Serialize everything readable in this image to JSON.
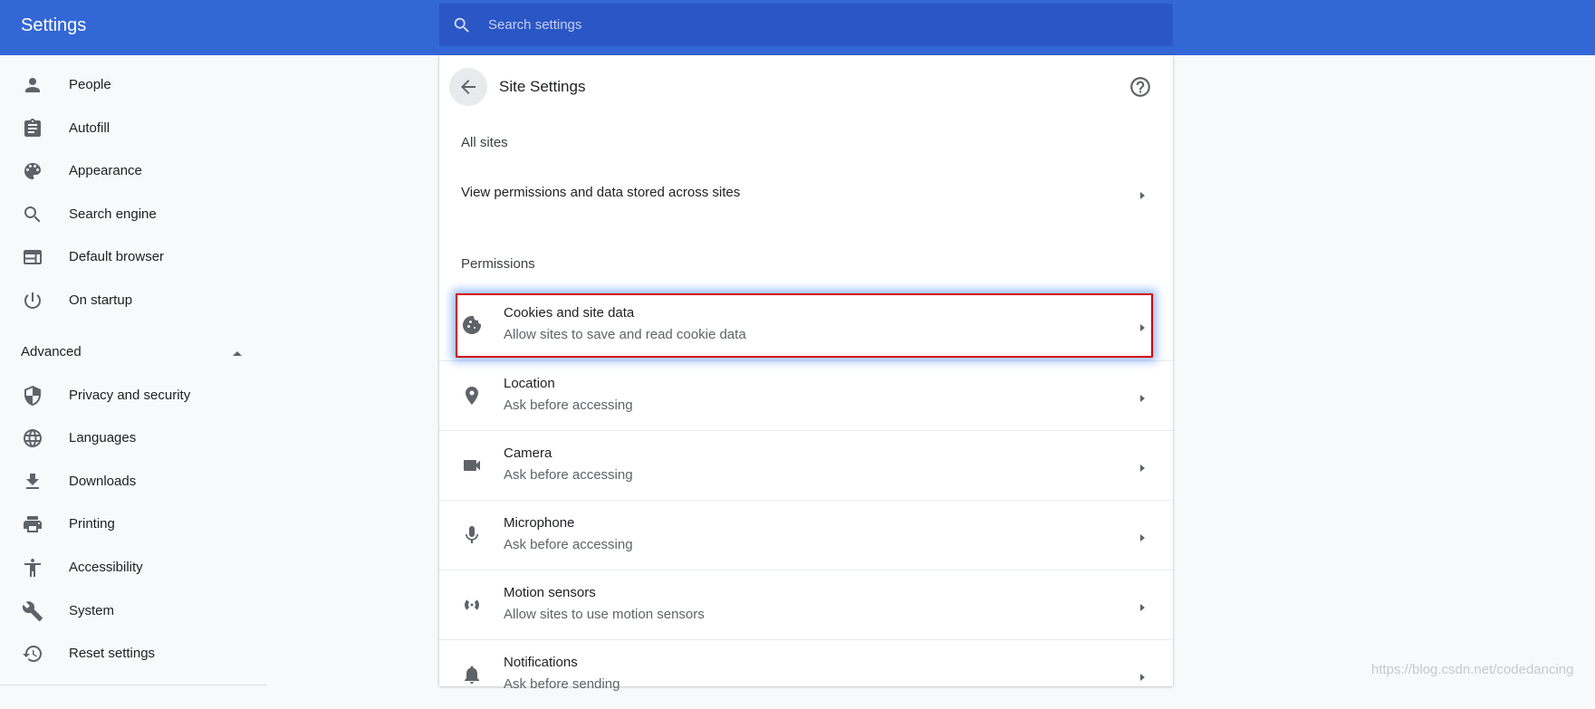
{
  "header": {
    "app_title": "Settings",
    "search_placeholder": "Search settings"
  },
  "sidebar": {
    "items": [
      {
        "label": "People",
        "icon": "person-icon"
      },
      {
        "label": "Autofill",
        "icon": "clipboard-icon"
      },
      {
        "label": "Appearance",
        "icon": "palette-icon"
      },
      {
        "label": "Search engine",
        "icon": "search-icon"
      },
      {
        "label": "Default browser",
        "icon": "browser-icon"
      },
      {
        "label": "On startup",
        "icon": "power-icon"
      }
    ],
    "advanced_label": "Advanced",
    "advanced_items": [
      {
        "label": "Privacy and security",
        "icon": "shield-icon"
      },
      {
        "label": "Languages",
        "icon": "globe-icon"
      },
      {
        "label": "Downloads",
        "icon": "download-icon"
      },
      {
        "label": "Printing",
        "icon": "printer-icon"
      },
      {
        "label": "Accessibility",
        "icon": "accessibility-icon"
      },
      {
        "label": "System",
        "icon": "wrench-icon"
      },
      {
        "label": "Reset settings",
        "icon": "history-icon"
      }
    ]
  },
  "main": {
    "title": "Site Settings",
    "all_sites_heading": "All sites",
    "all_sites_link": "View permissions and data stored across sites",
    "permissions_heading": "Permissions",
    "permissions": [
      {
        "title": "Cookies and site data",
        "subtitle": "Allow sites to save and read cookie data",
        "icon": "cookie-icon",
        "highlighted": true
      },
      {
        "title": "Location",
        "subtitle": "Ask before accessing",
        "icon": "location-pin-icon"
      },
      {
        "title": "Camera",
        "subtitle": "Ask before accessing",
        "icon": "camera-icon"
      },
      {
        "title": "Microphone",
        "subtitle": "Ask before accessing",
        "icon": "microphone-icon"
      },
      {
        "title": "Motion sensors",
        "subtitle": "Allow sites to use motion sensors",
        "icon": "sensors-icon"
      },
      {
        "title": "Notifications",
        "subtitle": "Ask before sending",
        "icon": "bell-icon"
      }
    ]
  },
  "watermark": "https://blog.csdn.net/codedancing",
  "colors": {
    "header_bg": "#3367d6",
    "search_bg": "#2a56c6",
    "highlight_border": "#d50000",
    "highlight_glow": "#4285f4"
  }
}
